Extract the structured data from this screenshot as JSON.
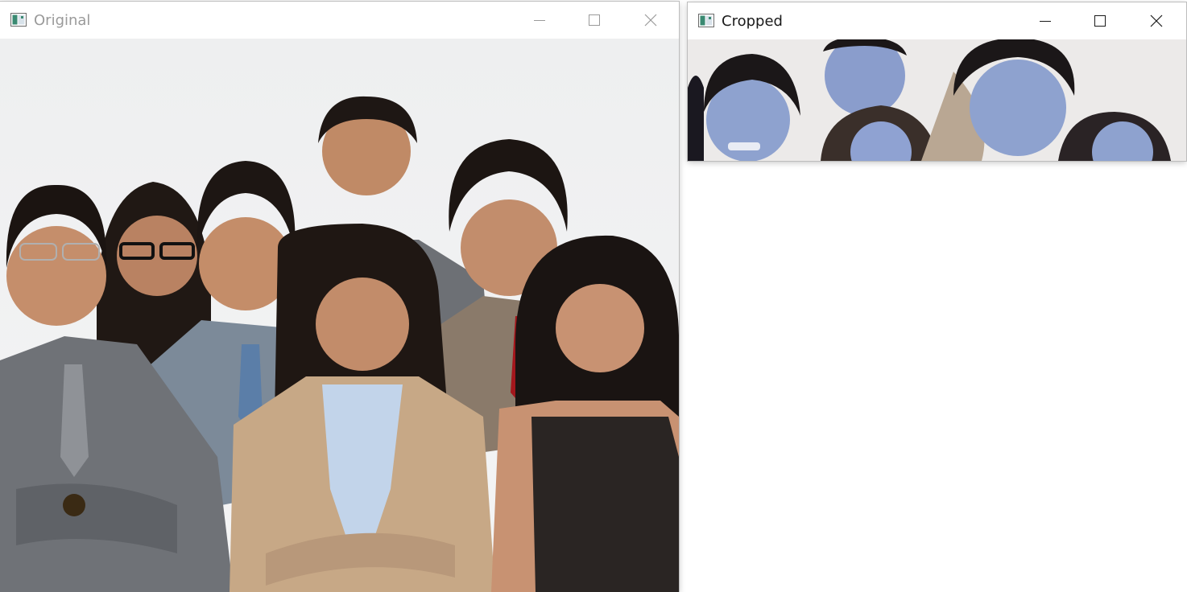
{
  "windows": {
    "original": {
      "title": "Original",
      "icon": "opencv-window-icon",
      "image": "group-photo"
    },
    "cropped": {
      "title": "Cropped",
      "icon": "opencv-window-icon",
      "image": "cropped-faces-strip"
    }
  },
  "controls": [
    "minimize-icon",
    "maximize-icon",
    "close-icon"
  ],
  "colors": {
    "background": "#ffffff",
    "title_inactive": "#9a9a9a",
    "title_active": "#1a1a1a",
    "suit_gray": "#6f7277",
    "suit_beige": "#c7a886",
    "tie_red": "#a3161c"
  }
}
